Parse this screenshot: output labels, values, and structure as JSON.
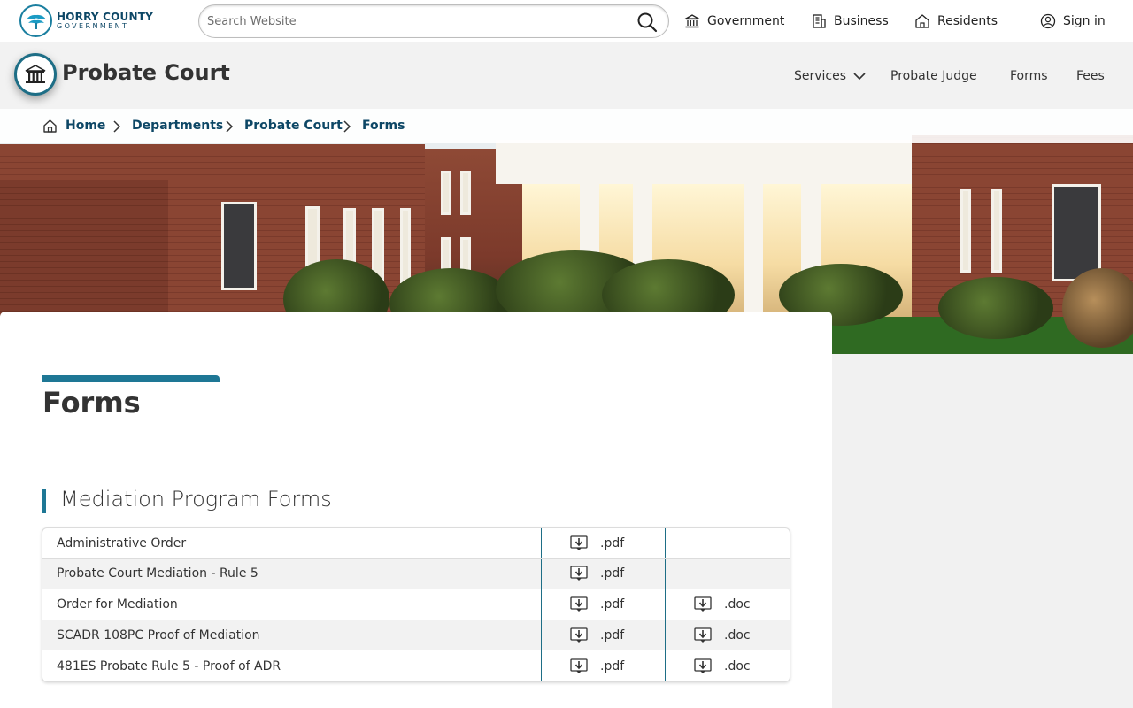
{
  "site": {
    "logo_line1": "HORRY COUNTY",
    "logo_line2": "GOVERNMENT",
    "search_placeholder": "Search Website",
    "nav": [
      {
        "label": "Government",
        "icon": "capitol-icon"
      },
      {
        "label": "Business",
        "icon": "building-icon"
      },
      {
        "label": "Residents",
        "icon": "house-icon"
      },
      {
        "label": "Sign in",
        "icon": "user-circle-icon"
      }
    ]
  },
  "department": {
    "title": "Probate Court",
    "nav": [
      {
        "label": "Services",
        "has_dropdown": true
      },
      {
        "label": "Probate Judge"
      },
      {
        "label": "Forms"
      },
      {
        "label": "Fees"
      }
    ]
  },
  "breadcrumb": [
    "Home",
    "Departments",
    "Probate Court",
    "Forms"
  ],
  "page": {
    "title": "Forms",
    "section_title": "Mediation Program Forms",
    "rows": [
      {
        "name": "Administrative Order",
        "pdf": ".pdf",
        "doc": ""
      },
      {
        "name": "Probate Court Mediation - Rule 5",
        "pdf": ".pdf",
        "doc": ""
      },
      {
        "name": "Order for Mediation",
        "pdf": ".pdf",
        "doc": ".doc"
      },
      {
        "name": "SCADR 108PC Proof of Mediation",
        "pdf": ".pdf",
        "doc": ".doc"
      },
      {
        "name": "481ES Probate Rule 5 - Proof of ADR",
        "pdf": ".pdf",
        "doc": ".doc"
      }
    ]
  },
  "colors": {
    "accent": "#1e7795",
    "brand_dark": "#0d4766",
    "page_bg": "#f1f1f1"
  }
}
